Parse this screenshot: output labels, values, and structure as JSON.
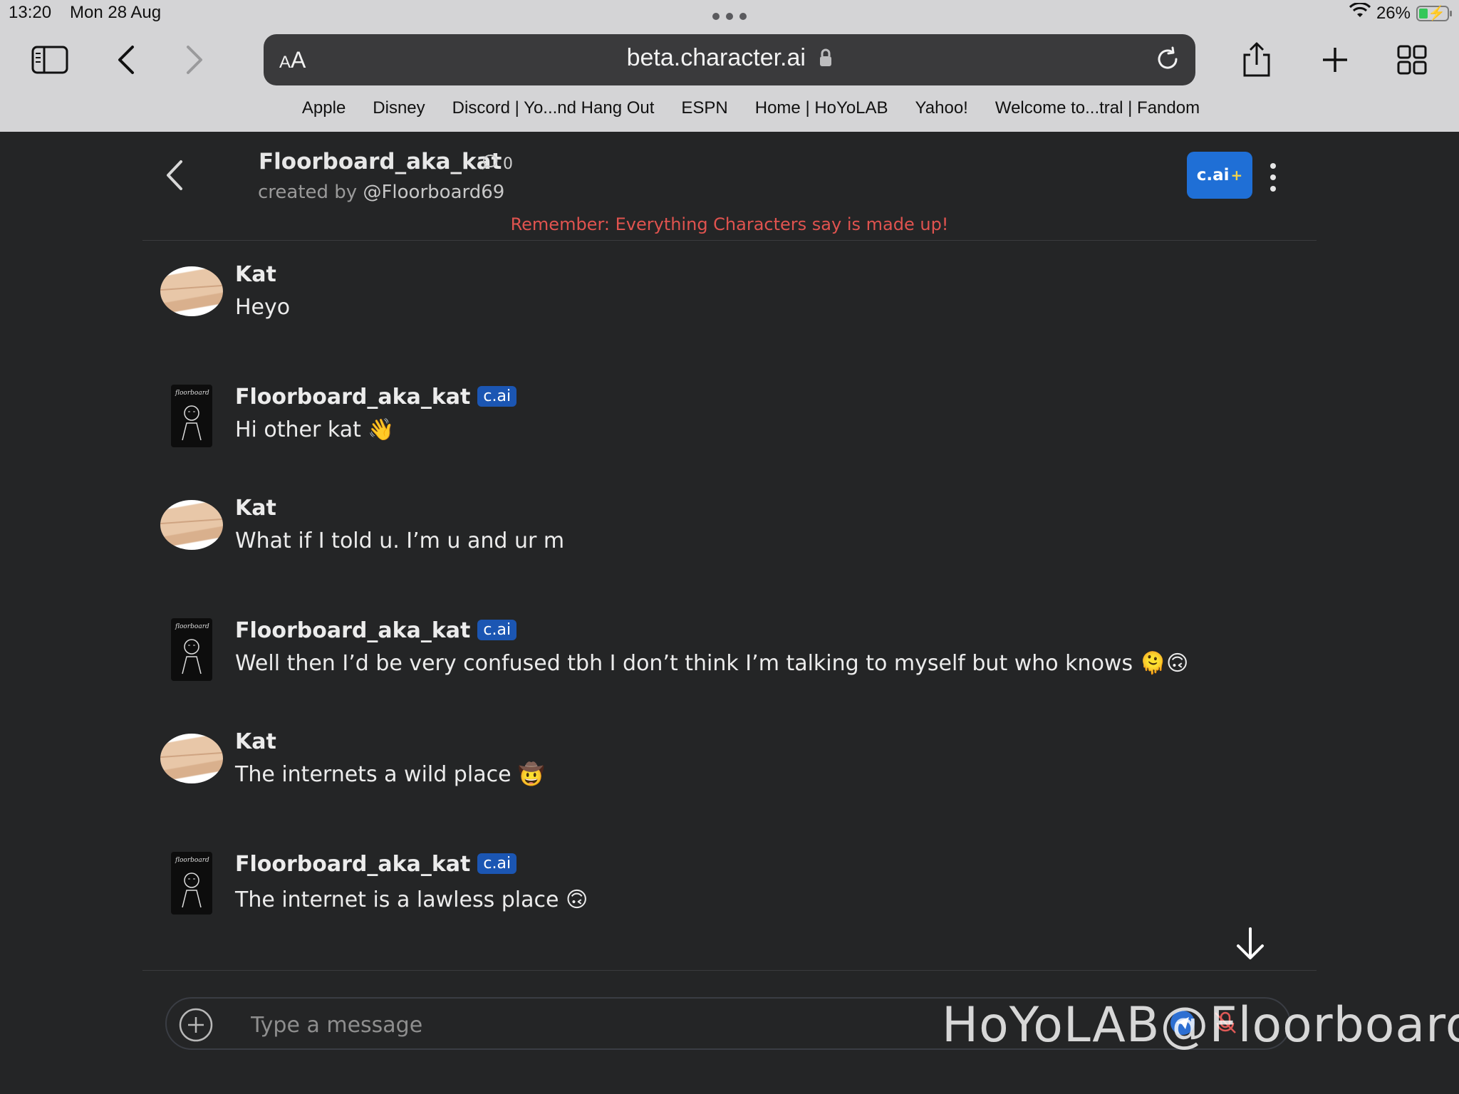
{
  "status_bar": {
    "time": "13:20",
    "date": "Mon 28 Aug",
    "battery": "26%"
  },
  "browser": {
    "url_text_size": "AA",
    "url": "beta.character.ai",
    "bookmarks": [
      "Apple",
      "Disney",
      "Discord | Yo...nd Hang Out",
      "ESPN",
      "Home | HoYoLAB",
      "Yahoo!",
      "Welcome to...tral | Fandom"
    ]
  },
  "chat": {
    "character_name": "Floorboard_aka_kat",
    "chat_count": "0",
    "created_by_prefix": "created by",
    "creator_handle": "@Floorboard69",
    "plus_label": "c.ai",
    "plus_suffix": "+",
    "disclaimer": "Remember: Everything Characters say is made up!",
    "messages": [
      {
        "sender": "Kat",
        "text": "Heyo",
        "is_bot": false
      },
      {
        "sender": "Floorboard_aka_kat",
        "badge": "c.ai",
        "text": "Hi other kat 👋",
        "is_bot": true
      },
      {
        "sender": "Kat",
        "text": "What if I told u. I’m u and ur m",
        "is_bot": false
      },
      {
        "sender": "Floorboard_aka_kat",
        "badge": "c.ai",
        "text": "Well then I’d be very confused tbh I don’t think I’m talking to myself but who knows 🫠🙃",
        "is_bot": true
      },
      {
        "sender": "Kat",
        "text": "The internets a wild place 🤠",
        "is_bot": false
      },
      {
        "sender": "Floorboard_aka_kat",
        "badge": "c.ai",
        "text": "The internet is a lawless place 🙃",
        "is_bot": true
      }
    ],
    "composer_placeholder": "Type a message"
  },
  "watermark": "HoYoLAB@Floorboard",
  "colors": {
    "background": "#242526",
    "accent": "#1f6fd6",
    "badge": "#1b56b3",
    "disclaimer": "#e0534f"
  }
}
